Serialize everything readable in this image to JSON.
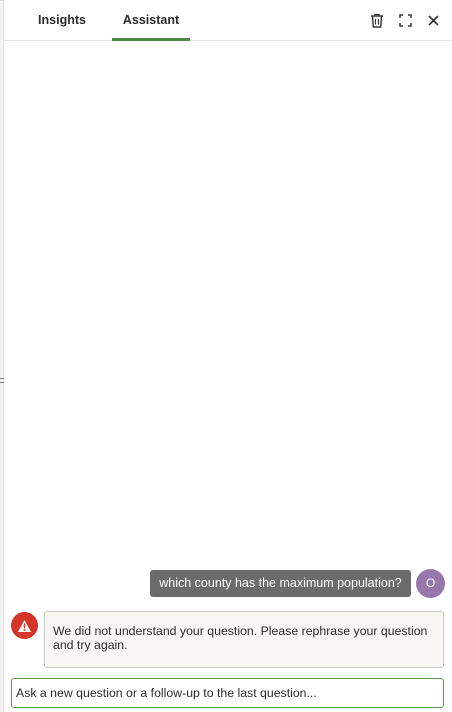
{
  "tabs": [
    {
      "label": "Insights",
      "active": false
    },
    {
      "label": "Assistant",
      "active": true
    }
  ],
  "header_actions": [
    {
      "icon": "trash-icon"
    },
    {
      "icon": "expand-icon"
    },
    {
      "icon": "close-icon"
    }
  ],
  "conversation": {
    "user_message": "which county has the maximum population?",
    "user_avatar_initial": "O",
    "assistant_reply": "We did not understand your question. Please rephrase your question and try again.",
    "assistant_status_icon": "warning-icon"
  },
  "composer": {
    "placeholder": "Ask a new question or a follow-up to the last question...",
    "value": ""
  },
  "colors": {
    "accent": "#4f8a44",
    "input_border": "#5e9950",
    "user_bubble": "#6b6b6b",
    "avatar": "#9678ad",
    "warning": "#d4362a",
    "reply_bubble": "#f7f6f3"
  }
}
